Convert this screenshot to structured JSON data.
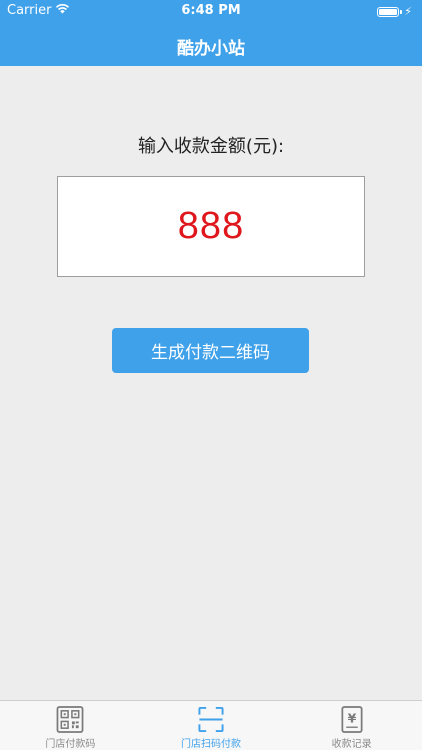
{
  "status_bar": {
    "carrier": "Carrier",
    "time": "6:48 PM",
    "wifi_icon": "wifi-icon",
    "battery_icon": "battery-icon",
    "charging_icon": "⚡"
  },
  "nav": {
    "title": "酷办小站"
  },
  "form": {
    "amount_label": "输入收款金额(元):",
    "amount_value": "888",
    "generate_label": "生成付款二维码"
  },
  "tabs": [
    {
      "label": "门店付款码",
      "icon": "qr-code-icon",
      "active": false
    },
    {
      "label": "门店扫码付款",
      "icon": "scan-icon",
      "active": true
    },
    {
      "label": "收款记录",
      "icon": "yuan-receipt-icon",
      "active": false
    }
  ],
  "colors": {
    "accent": "#3fa1ea",
    "amount": "#e0161d",
    "background": "#ededed",
    "tab_inactive": "#8a8a8a"
  }
}
